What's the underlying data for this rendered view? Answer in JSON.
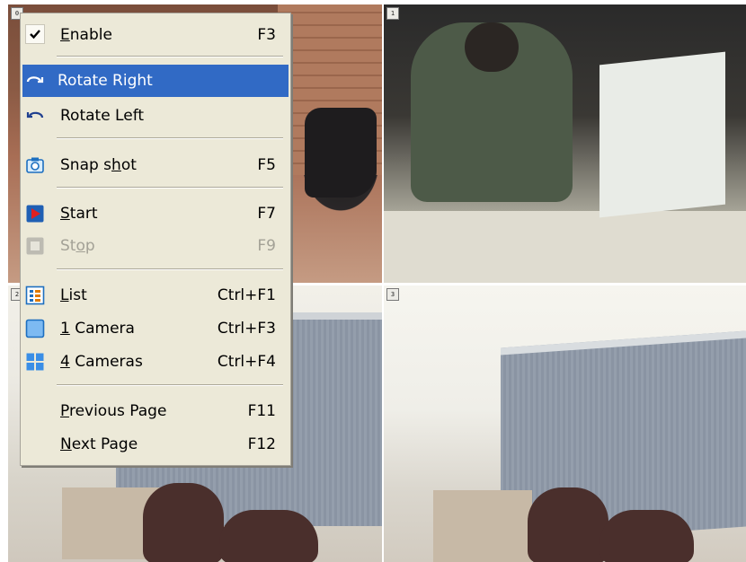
{
  "cameras": [
    {
      "tag": "0"
    },
    {
      "tag": "1"
    },
    {
      "tag": "2"
    },
    {
      "tag": "3"
    }
  ],
  "menu": {
    "items": [
      {
        "label_pre": "",
        "label_u": "E",
        "label_post": "nable",
        "accel": "F3",
        "checked": true
      },
      {
        "label_pre": "Rotate Right",
        "label_u": "",
        "label_post": "",
        "accel": "",
        "icon": "rotate-right-icon",
        "selected": true
      },
      {
        "label_pre": "Rotate Left",
        "label_u": "",
        "label_post": "",
        "accel": "",
        "icon": "rotate-left-icon"
      },
      {
        "label_pre": "Snap s",
        "label_u": "h",
        "label_post": "ot",
        "accel": "F5",
        "icon": "camera-icon"
      },
      {
        "label_pre": "",
        "label_u": "S",
        "label_post": "tart",
        "accel": "F7",
        "icon": "play-icon"
      },
      {
        "label_pre": "St",
        "label_u": "o",
        "label_post": "p",
        "accel": "F9",
        "icon": "stop-icon",
        "disabled": true
      },
      {
        "label_pre": "",
        "label_u": "L",
        "label_post": "ist",
        "accel": "Ctrl+F1",
        "icon": "list-icon"
      },
      {
        "label_pre": "",
        "label_u": "1",
        "label_post": " Camera",
        "accel": "Ctrl+F3",
        "icon": "single-camera-icon"
      },
      {
        "label_pre": "",
        "label_u": "4",
        "label_post": " Cameras",
        "accel": "Ctrl+F4",
        "icon": "quad-cameras-icon"
      },
      {
        "label_pre": "",
        "label_u": "P",
        "label_post": "revious Page",
        "accel": "F11"
      },
      {
        "label_pre": "",
        "label_u": "N",
        "label_post": "ext Page",
        "accel": "F12"
      }
    ]
  },
  "colors": {
    "menu_bg": "#ece9d8",
    "selection": "#316ac5",
    "disabled_text": "#a3a196"
  }
}
